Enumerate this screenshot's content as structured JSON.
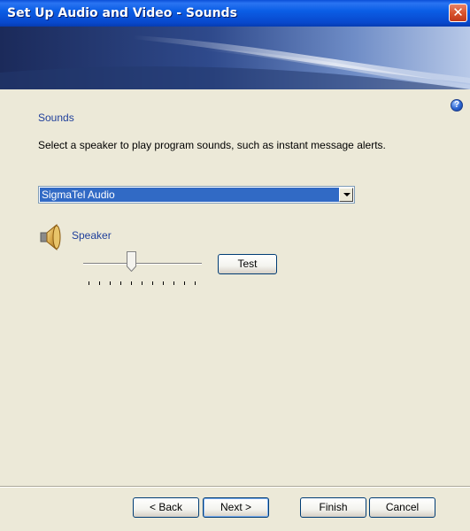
{
  "window": {
    "title": "Set Up Audio and Video - Sounds",
    "close_glyph": "✕"
  },
  "help_glyph": "?",
  "section": {
    "title": "Sounds",
    "description": "Select a speaker to play program sounds, such as instant message alerts."
  },
  "device": {
    "selected": "SigmaTel Audio"
  },
  "speaker": {
    "label": "Speaker",
    "volume_fraction": 0.4,
    "tick_count": 11,
    "test_label": "Test"
  },
  "buttons": {
    "back": "< Back",
    "next": "Next >",
    "finish": "Finish",
    "cancel": "Cancel"
  },
  "icons": [
    "close-icon",
    "help-icon",
    "chevron-down-icon",
    "speaker-icon"
  ],
  "colors": {
    "titlebar": "#0B5EE6",
    "background": "#ECE9D8",
    "selection": "#316AC5",
    "label_blue": "#1F3F9B"
  }
}
